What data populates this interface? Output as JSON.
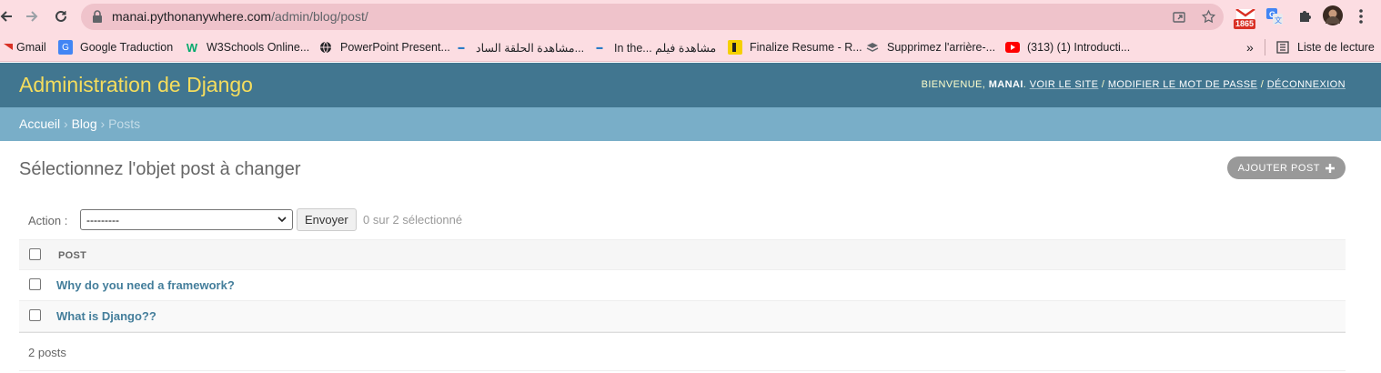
{
  "browser": {
    "url_host": "manai.pythonanywhere.com",
    "url_path": "/admin/blog/post/",
    "gmail_badge": "1865",
    "bookmarks": [
      {
        "label": "Gmail",
        "icon": "gmail-icon"
      },
      {
        "label": "Google Traduction",
        "icon": "google-translate-icon"
      },
      {
        "label": "W3Schools Online...",
        "icon": "w3schools-icon"
      },
      {
        "label": "PowerPoint Present...",
        "icon": "globe-icon"
      },
      {
        "label": "مشاهدة الحلقة الساد...",
        "icon": "site-icon"
      },
      {
        "label": "In the... مشاهدة فيلم",
        "icon": "site-icon"
      },
      {
        "label": "Finalize Resume - R...",
        "icon": "resume-icon"
      },
      {
        "label": "Supprimez l'arrière-...",
        "icon": "layers-icon"
      },
      {
        "label": "(313) (1) Introducti...",
        "icon": "youtube-icon"
      }
    ],
    "more_bookmarks": "»",
    "reading_list": "Liste de lecture",
    "colors": {
      "chrome": "#fcdde2",
      "omnibox": "#efc3cb"
    }
  },
  "admin": {
    "branding": "Administration de Django",
    "user_tools": {
      "welcome": "BIENVENUE,",
      "username": "MANAI",
      "view_site": "VOIR LE SITE",
      "change_password": "MODIFIER LE MOT DE PASSE",
      "logout": "DÉCONNEXION",
      "separator": "/"
    },
    "breadcrumbs": {
      "home": "Accueil",
      "app": "Blog",
      "current": "Posts",
      "sep": "›"
    },
    "title": "Sélectionnez l'objet post à changer",
    "add_button": "AJOUTER POST",
    "actions": {
      "label": "Action :",
      "selected_option": "---------",
      "go_button": "Envoyer",
      "counter": "0 sur 2 sélectionné"
    },
    "table": {
      "column": "POST",
      "rows": [
        {
          "title": "Why do you need a framework?"
        },
        {
          "title": "What is Django??"
        }
      ]
    },
    "paginator": "2 posts",
    "colors": {
      "header": "#417690",
      "breadcrumbs": "#79aec8",
      "branding": "#f5dd5d",
      "link": "#447e9b"
    }
  }
}
